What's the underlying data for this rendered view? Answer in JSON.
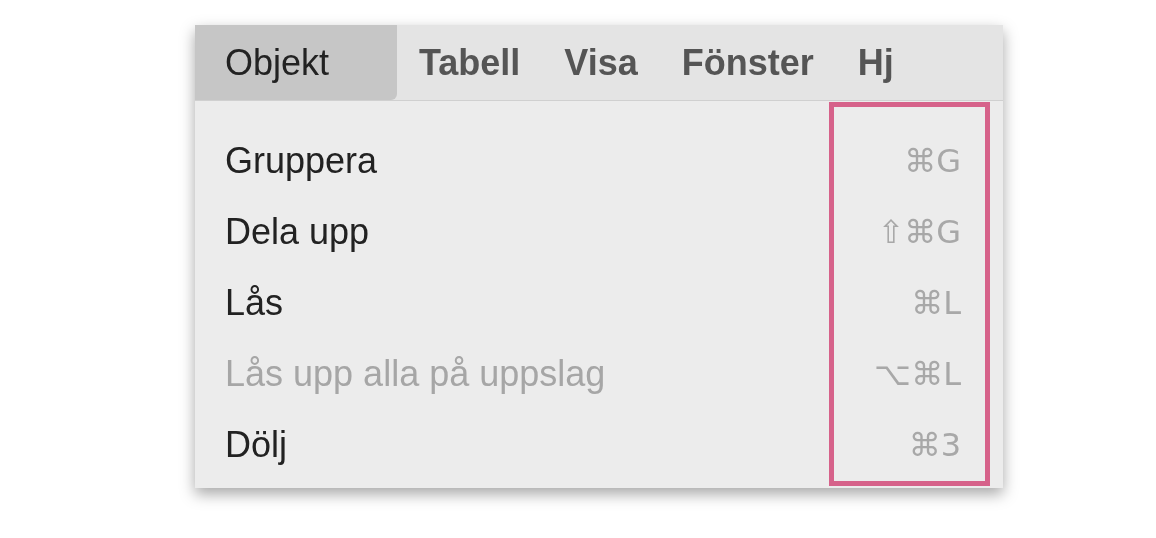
{
  "menubar": {
    "items": [
      {
        "label": "Objekt",
        "selected": true
      },
      {
        "label": "Tabell",
        "selected": false
      },
      {
        "label": "Visa",
        "selected": false
      },
      {
        "label": "Fönster",
        "selected": false
      },
      {
        "label": "Hj",
        "selected": false
      }
    ]
  },
  "menu": {
    "items": [
      {
        "label": "Gruppera",
        "shortcut": "⌘G",
        "disabled": false
      },
      {
        "label": "Dela upp",
        "shortcut": "⇧⌘G",
        "disabled": false
      },
      {
        "label": "Lås",
        "shortcut": "⌘L",
        "disabled": false
      },
      {
        "label": "Lås upp alla på uppslag",
        "shortcut": "⌥⌘L",
        "disabled": true
      },
      {
        "label": "Dölj",
        "shortcut": "⌘3",
        "disabled": false
      }
    ]
  }
}
